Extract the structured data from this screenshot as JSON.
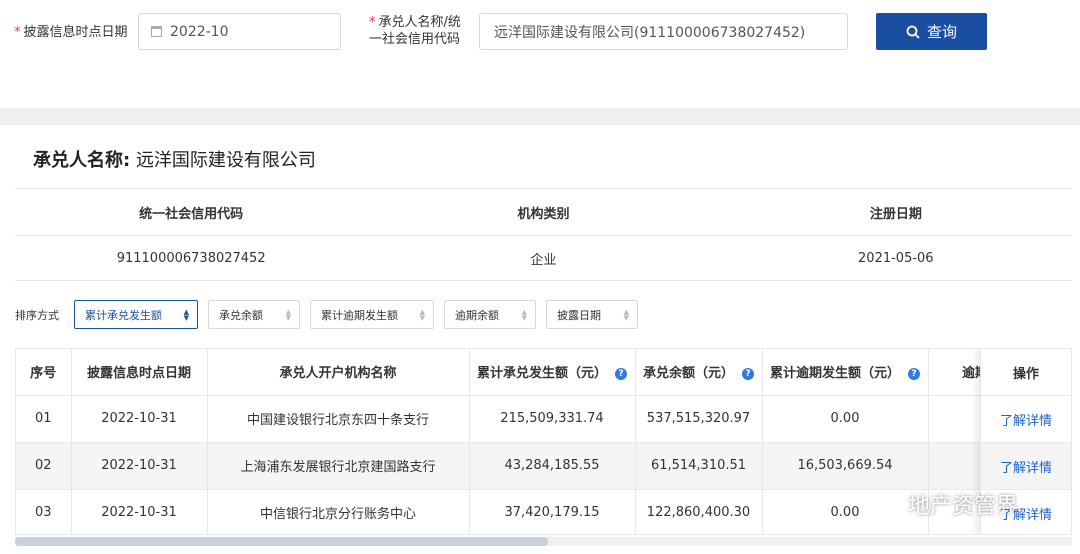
{
  "search": {
    "date_label": "披露信息时点日期",
    "date_value": "2022-10",
    "acceptor_label_line1": "承兑人名称/统",
    "acceptor_label_line2": "一社会信用代码",
    "acceptor_value": "远洋国际建设有限公司(911100006738027452)",
    "query_button": "查询",
    "required_mark": "*"
  },
  "company": {
    "title_label": "承兑人名称:",
    "title_value": "远洋国际建设有限公司",
    "headers": [
      "统一社会信用代码",
      "机构类别",
      "注册日期"
    ],
    "values": [
      "911100006738027452",
      "企业",
      "2021-05-06"
    ]
  },
  "sort": {
    "label": "排序方式",
    "options": [
      "累计承兑发生额",
      "承兑余额",
      "累计逾期发生额",
      "逾期余额",
      "披露日期"
    ],
    "active_index": 0
  },
  "table": {
    "headers": [
      "序号",
      "披露信息时点日期",
      "承兑人开户机构名称",
      "累计承兑发生额（元）",
      "承兑余额（元）",
      "累计逾期发生额（元）",
      "逾期余额"
    ],
    "op_header": "操作",
    "rows": [
      {
        "idx": "01",
        "date": "2022-10-31",
        "bank": "中国建设银行北京东四十条支行",
        "accept_total": "215,509,331.74",
        "accept_balance": "537,515,320.97",
        "overdue_total": "0.00",
        "overdue_balance": "",
        "op": "了解详情"
      },
      {
        "idx": "02",
        "date": "2022-10-31",
        "bank": "上海浦东发展银行北京建国路支行",
        "accept_total": "43,284,185.55",
        "accept_balance": "61,514,310.51",
        "overdue_total": "16,503,669.54",
        "overdue_balance": "",
        "op": "了解详情"
      },
      {
        "idx": "03",
        "date": "2022-10-31",
        "bank": "中信银行北京分行账务中心",
        "accept_total": "37,420,179.15",
        "accept_balance": "122,860,400.30",
        "overdue_total": "0.00",
        "overdue_balance": "",
        "op": "了解详情"
      }
    ]
  },
  "watermark": {
    "text": "地产资管界",
    "icon": "wechat-icon"
  },
  "colors": {
    "primary": "#1a4ea0",
    "link": "#1a63c8",
    "required": "#e33333",
    "help": "#2f7be0"
  }
}
